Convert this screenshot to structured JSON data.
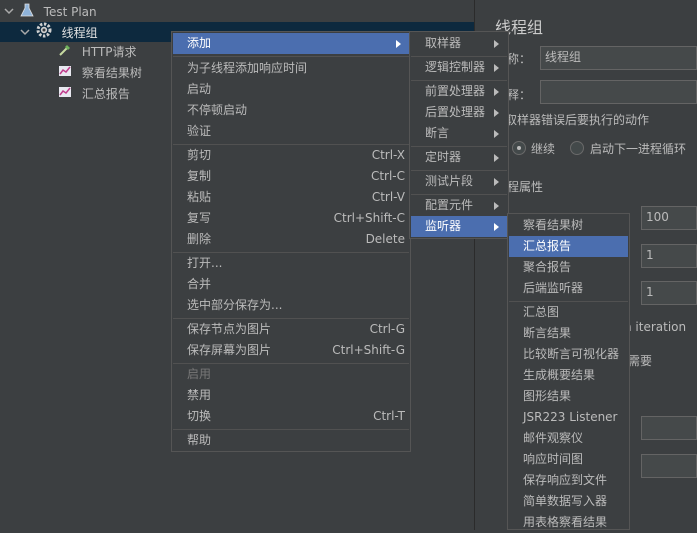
{
  "tree": {
    "items": [
      {
        "label": "Test Plan"
      },
      {
        "label": "线程组"
      },
      {
        "label": "HTTP请求"
      },
      {
        "label": "察看结果树"
      },
      {
        "label": "汇总报告"
      }
    ]
  },
  "right_panel": {
    "title": "线程组",
    "name_label": "称：",
    "name_value": "线程组",
    "comment_label": "释：",
    "error_action_label": "取样器错误后要执行的动作",
    "radio_continue": "继续",
    "radio_next_loop": "启动下一进程循环",
    "thread_props_label": "程属性",
    "threads_value": "100",
    "rampup_value": "1",
    "loop_value": "1",
    "iteration_text": "n iteration",
    "need_text": "需要"
  },
  "context_menu": {
    "items": [
      {
        "label": "添加",
        "shortcut": ""
      },
      {
        "label": "为子线程添加响应时间",
        "shortcut": ""
      },
      {
        "label": "启动",
        "shortcut": ""
      },
      {
        "label": "不停顿启动",
        "shortcut": ""
      },
      {
        "label": "验证",
        "shortcut": ""
      },
      {
        "label": "剪切",
        "shortcut": "Ctrl-X"
      },
      {
        "label": "复制",
        "shortcut": "Ctrl-C"
      },
      {
        "label": "粘贴",
        "shortcut": "Ctrl-V"
      },
      {
        "label": "复写",
        "shortcut": "Ctrl+Shift-C"
      },
      {
        "label": "删除",
        "shortcut": "Delete"
      },
      {
        "label": "打开...",
        "shortcut": ""
      },
      {
        "label": "合并",
        "shortcut": ""
      },
      {
        "label": "选中部分保存为...",
        "shortcut": ""
      },
      {
        "label": "保存节点为图片",
        "shortcut": "Ctrl-G"
      },
      {
        "label": "保存屏幕为图片",
        "shortcut": "Ctrl+Shift-G"
      },
      {
        "label": "启用",
        "shortcut": ""
      },
      {
        "label": "禁用",
        "shortcut": ""
      },
      {
        "label": "切换",
        "shortcut": "Ctrl-T"
      },
      {
        "label": "帮助",
        "shortcut": ""
      }
    ]
  },
  "add_submenu": {
    "items": [
      {
        "label": "取样器"
      },
      {
        "label": "逻辑控制器"
      },
      {
        "label": "前置处理器"
      },
      {
        "label": "后置处理器"
      },
      {
        "label": "断言"
      },
      {
        "label": "定时器"
      },
      {
        "label": "测试片段"
      },
      {
        "label": "配置元件"
      },
      {
        "label": "监听器"
      }
    ]
  },
  "listener_submenu": {
    "items": [
      {
        "label": "察看结果树"
      },
      {
        "label": "汇总报告"
      },
      {
        "label": "聚合报告"
      },
      {
        "label": "后端监听器"
      },
      {
        "label": "汇总图"
      },
      {
        "label": "断言结果"
      },
      {
        "label": "比较断言可视化器"
      },
      {
        "label": "生成概要结果"
      },
      {
        "label": "图形结果"
      },
      {
        "label": "JSR223 Listener"
      },
      {
        "label": "邮件观察仪"
      },
      {
        "label": "响应时间图"
      },
      {
        "label": "保存响应到文件"
      },
      {
        "label": "简单数据写入器"
      },
      {
        "label": "用表格察看结果"
      }
    ]
  },
  "colors": {
    "background": "#3c3f41",
    "highlight": "#4b6eaf",
    "tree_selection": "#0d293e"
  }
}
